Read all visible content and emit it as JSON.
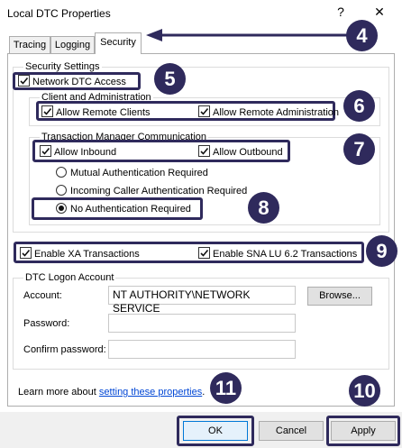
{
  "window": {
    "title": "Local DTC Properties",
    "help_glyph": "?",
    "close_glyph": "✕"
  },
  "tabs": [
    {
      "label": "Tracing",
      "active": false
    },
    {
      "label": "Logging",
      "active": false
    },
    {
      "label": "Security",
      "active": true
    }
  ],
  "security_settings": {
    "legend": "Security Settings",
    "network_dtc_access": {
      "label": "Network DTC Access",
      "checked": true
    },
    "client_admin": {
      "legend": "Client and Administration",
      "allow_remote_clients": {
        "label": "Allow Remote Clients",
        "checked": true
      },
      "allow_remote_administration": {
        "label": "Allow Remote Administration",
        "checked": true
      }
    },
    "tm_communication": {
      "legend": "Transaction Manager Communication",
      "allow_inbound": {
        "label": "Allow Inbound",
        "checked": true
      },
      "allow_outbound": {
        "label": "Allow Outbound",
        "checked": true
      },
      "auth_options": [
        {
          "label": "Mutual Authentication Required",
          "selected": false
        },
        {
          "label": "Incoming Caller Authentication Required",
          "selected": false
        },
        {
          "label": "No Authentication Required",
          "selected": true
        }
      ]
    }
  },
  "xa": {
    "label": "Enable XA Transactions",
    "checked": true
  },
  "sna": {
    "label": "Enable SNA LU 6.2 Transactions",
    "checked": true
  },
  "logon": {
    "legend": "DTC Logon Account",
    "account_label": "Account:",
    "account_value": "NT AUTHORITY\\NETWORK SERVICE",
    "browse_label": "Browse...",
    "password_label": "Password:",
    "password_value": "",
    "confirm_label": "Confirm password:",
    "confirm_value": ""
  },
  "learn_more": {
    "prefix": "Learn more about ",
    "link": "setting these properties",
    "suffix": "."
  },
  "buttons": {
    "ok": "OK",
    "cancel": "Cancel",
    "apply": "Apply"
  },
  "annotations": {
    "b4": "4",
    "b5": "5",
    "b6": "6",
    "b7": "7",
    "b8": "8",
    "b9": "9",
    "b10": "10",
    "b11": "11",
    "color": "#2f2a5c"
  }
}
